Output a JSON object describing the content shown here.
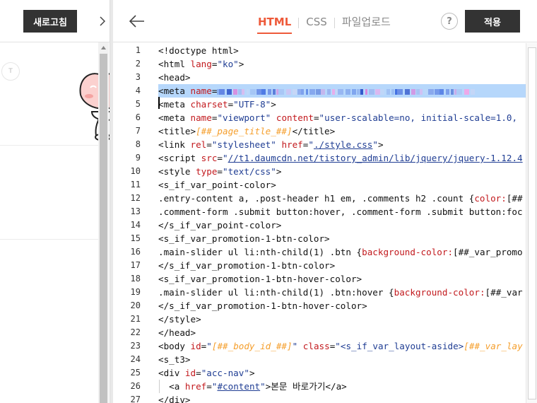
{
  "left_panel": {
    "refresh_label": "새로고침",
    "collapse_icon": "chevron-right-icon",
    "avatar_letter": "T",
    "mascot_icon": "peach-mascot-icon"
  },
  "toolbar": {
    "back_icon": "arrow-left-icon",
    "tabs": [
      {
        "label": "HTML",
        "active": true
      },
      {
        "label": "CSS",
        "active": false
      },
      {
        "label": "파일업로드",
        "active": false
      }
    ],
    "help_label": "?",
    "apply_label": "적용"
  },
  "colors": {
    "accent": "#ee5a3a",
    "button_dark": "#333333",
    "selection": "#b6d7fb",
    "attr": "#c2191d",
    "string": "#1f3d93",
    "template_var": "#f59f2d"
  },
  "code": {
    "selected_line": 4,
    "cursor_line": 5,
    "lines": [
      {
        "n": "1",
        "segs": [
          [
            "t",
            "<!doctype html>"
          ]
        ]
      },
      {
        "n": "2",
        "segs": [
          [
            "t",
            "<html "
          ],
          [
            "a",
            "lang"
          ],
          [
            "t",
            "="
          ],
          [
            "s",
            "\"ko\""
          ],
          [
            "t",
            ">"
          ]
        ]
      },
      {
        "n": "3",
        "segs": [
          [
            "t",
            "<head>"
          ]
        ]
      },
      {
        "n": "4",
        "segs": [
          [
            "t",
            "<meta "
          ],
          [
            "a",
            "name"
          ],
          [
            "t",
            "="
          ],
          [
            "blur",
            ""
          ]
        ]
      },
      {
        "n": "5",
        "segs": [
          [
            "t",
            "<meta "
          ],
          [
            "a",
            "charset"
          ],
          [
            "t",
            "="
          ],
          [
            "s",
            "\"UTF-8\""
          ],
          [
            "t",
            ">"
          ]
        ]
      },
      {
        "n": "6",
        "segs": [
          [
            "t",
            "<meta "
          ],
          [
            "a",
            "name"
          ],
          [
            "t",
            "="
          ],
          [
            "s",
            "\"viewport\""
          ],
          [
            "t",
            " "
          ],
          [
            "a",
            "content"
          ],
          [
            "t",
            "="
          ],
          [
            "s",
            "\"user-scalable=no, initial-scale=1.0,"
          ]
        ]
      },
      {
        "n": "7",
        "segs": [
          [
            "t",
            "<title>"
          ],
          [
            "v",
            "[##_page_title_##]"
          ],
          [
            "t",
            "</title>"
          ]
        ]
      },
      {
        "n": "8",
        "segs": [
          [
            "t",
            "<link "
          ],
          [
            "a",
            "rel"
          ],
          [
            "t",
            "="
          ],
          [
            "s",
            "\"stylesheet\""
          ],
          [
            "t",
            " "
          ],
          [
            "a",
            "href"
          ],
          [
            "t",
            "="
          ],
          [
            "s",
            "\""
          ],
          [
            "l",
            "./style.css"
          ],
          [
            "s",
            "\""
          ],
          [
            "t",
            ">"
          ]
        ]
      },
      {
        "n": "9",
        "segs": [
          [
            "t",
            "<script "
          ],
          [
            "a",
            "src"
          ],
          [
            "t",
            "="
          ],
          [
            "s",
            "\""
          ],
          [
            "l",
            "//t1.daumcdn.net/tistory_admin/lib/jquery/jquery-1.12.4"
          ]
        ]
      },
      {
        "n": "10",
        "segs": [
          [
            "t",
            "<style "
          ],
          [
            "a",
            "type"
          ],
          [
            "t",
            "="
          ],
          [
            "s",
            "\"text/css\""
          ],
          [
            "t",
            ">"
          ]
        ]
      },
      {
        "n": "11",
        "segs": [
          [
            "t",
            "<s_if_var_point-color>"
          ]
        ]
      },
      {
        "n": "12",
        "segs": [
          [
            "x",
            ".entry-content a, .post-header h1 em, .comments h2 .count {"
          ],
          [
            "a",
            "color:"
          ],
          [
            "x",
            "[##"
          ]
        ]
      },
      {
        "n": "13",
        "segs": [
          [
            "x",
            ".comment-form .submit button:hover, .comment-form .submit button:foc"
          ]
        ]
      },
      {
        "n": "14",
        "segs": [
          [
            "t",
            "</s_if_var_point-color>"
          ]
        ]
      },
      {
        "n": "15",
        "segs": [
          [
            "t",
            "<s_if_var_promotion-1-btn-color>"
          ]
        ]
      },
      {
        "n": "16",
        "segs": [
          [
            "x",
            ".main-slider ul li:nth-child(1) .btn {"
          ],
          [
            "a",
            "background-color:"
          ],
          [
            "x",
            "[##_var_promo"
          ]
        ]
      },
      {
        "n": "17",
        "segs": [
          [
            "t",
            "</s_if_var_promotion-1-btn-color>"
          ]
        ]
      },
      {
        "n": "18",
        "segs": [
          [
            "t",
            "<s_if_var_promotion-1-btn-hover-color>"
          ]
        ]
      },
      {
        "n": "19",
        "segs": [
          [
            "x",
            ".main-slider ul li:nth-child(1) .btn:hover {"
          ],
          [
            "a",
            "background-color:"
          ],
          [
            "x",
            "[##_var"
          ]
        ]
      },
      {
        "n": "20",
        "segs": [
          [
            "t",
            "</s_if_var_promotion-1-btn-hover-color>"
          ]
        ]
      },
      {
        "n": "21",
        "segs": [
          [
            "t",
            "</style>"
          ]
        ]
      },
      {
        "n": "22",
        "segs": [
          [
            "t",
            "</head>"
          ]
        ]
      },
      {
        "n": "23",
        "segs": [
          [
            "t",
            "<body "
          ],
          [
            "a",
            "id"
          ],
          [
            "t",
            "="
          ],
          [
            "s",
            "\""
          ],
          [
            "v",
            "[##_body_id_##]"
          ],
          [
            "s",
            "\""
          ],
          [
            "t",
            " "
          ],
          [
            "a",
            "class"
          ],
          [
            "t",
            "="
          ],
          [
            "s",
            "\"<s_if_var_layout-aside>"
          ],
          [
            "v",
            "[##_var_lay"
          ]
        ]
      },
      {
        "n": "24",
        "segs": [
          [
            "t",
            "<s_t3>"
          ]
        ]
      },
      {
        "n": "25",
        "segs": [
          [
            "t",
            "<div "
          ],
          [
            "a",
            "id"
          ],
          [
            "t",
            "="
          ],
          [
            "s",
            "\"acc-nav\""
          ],
          [
            "t",
            ">"
          ]
        ]
      },
      {
        "n": "26",
        "segs": [
          [
            "t",
            "  <a "
          ],
          [
            "a",
            "href"
          ],
          [
            "t",
            "="
          ],
          [
            "s",
            "\""
          ],
          [
            "l",
            "#content"
          ],
          [
            "s",
            "\""
          ],
          [
            "t",
            ">본문 바로가기</a>"
          ]
        ],
        "guide": true
      },
      {
        "n": "27",
        "segs": [
          [
            "t",
            "</div>"
          ]
        ]
      }
    ]
  }
}
